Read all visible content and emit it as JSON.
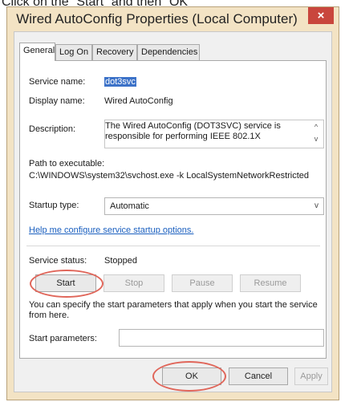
{
  "caption": "Click on the “Start” and then “OK”",
  "dialog": {
    "title": "Wired AutoConfig Properties (Local Computer)",
    "close_glyph": "×"
  },
  "tabs": [
    "General",
    "Log On",
    "Recovery",
    "Dependencies"
  ],
  "general": {
    "service_name_label": "Service name:",
    "service_name_value": "dot3svc",
    "display_name_label": "Display name:",
    "display_name_value": "Wired AutoConfig",
    "description_label": "Description:",
    "description_value": "The Wired AutoConfig (DOT3SVC) service is responsible for performing IEEE 802.1X",
    "path_label": "Path to executable:",
    "path_value": "C:\\WINDOWS\\system32\\svchost.exe -k LocalSystemNetworkRestricted",
    "startup_type_label": "Startup type:",
    "startup_type_value": "Automatic",
    "help_link": "Help me configure service startup options.",
    "service_status_label": "Service status:",
    "service_status_value": "Stopped",
    "buttons": {
      "start": "Start",
      "stop": "Stop",
      "pause": "Pause",
      "resume": "Resume"
    },
    "note": "You can specify the start parameters that apply when you start the service from here.",
    "start_params_label": "Start parameters:",
    "start_params_value": ""
  },
  "footer": {
    "ok": "OK",
    "cancel": "Cancel",
    "apply": "Apply"
  },
  "icons": {
    "scroll_up": "^",
    "scroll_down": "v",
    "dropdown": "v"
  },
  "colors": {
    "titlebar": "#f3e3c4",
    "close": "#c9463d",
    "annotation_circle": "#e0665a",
    "link": "#1a5fbf"
  }
}
